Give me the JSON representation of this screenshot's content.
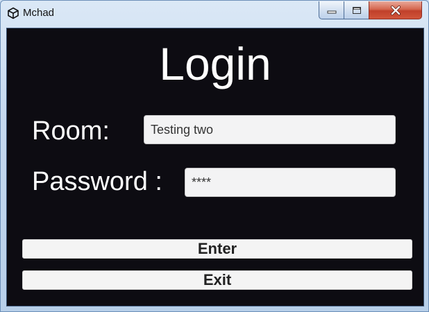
{
  "window": {
    "title": "Mchad",
    "controls": {
      "minimize_icon": "minimize-icon",
      "maximize_icon": "maximize-icon",
      "close_icon": "close-icon"
    }
  },
  "login": {
    "heading": "Login",
    "room_label": "Room:",
    "room_value": "Testing two",
    "password_label": "Password :",
    "password_value": "****",
    "enter_label": "Enter",
    "exit_label": "Exit"
  },
  "colors": {
    "background": "#0d0c12",
    "text": "#ffffff",
    "field": "#f3f3f4",
    "button": "#f4f4f4",
    "close_button": "#c94a33"
  }
}
